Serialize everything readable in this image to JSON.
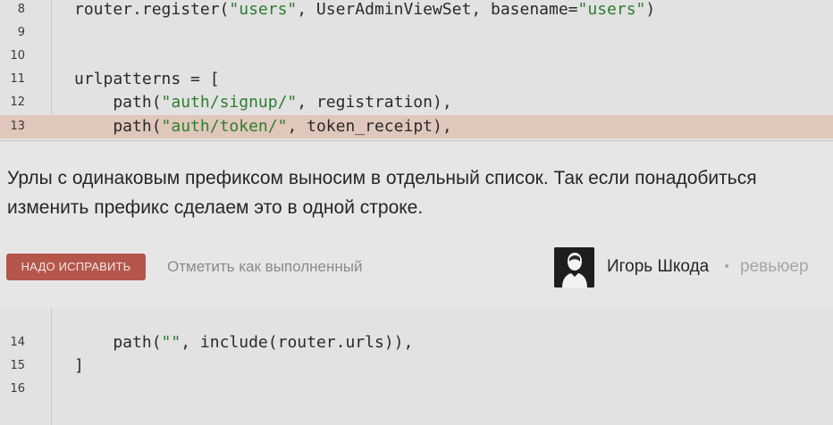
{
  "code_top": {
    "lines": [
      {
        "no": "8",
        "p1": "router.register(",
        "s1": "\"users\"",
        "p2": ", UserAdminViewSet, basename=",
        "s2": "\"users\"",
        "p3": ")"
      },
      {
        "no": "9"
      },
      {
        "no": "10"
      },
      {
        "no": "11",
        "p1": "urlpatterns = ["
      },
      {
        "no": "12",
        "p1": "    path(",
        "s1": "\"auth/signup/\"",
        "p2": ", registration),"
      },
      {
        "no": "13",
        "p1": "    path(",
        "s1": "\"auth/token/\"",
        "p2": ", token_receipt),"
      }
    ]
  },
  "comment": {
    "text": "Урлы с одинаковым префиксом выносим в отдельный список. Так если понадобиться изменить префикс сделаем это в одной строке.",
    "fix_button_label": "НАДО ИСПРАВИТЬ",
    "mark_done_label": "Отметить как выполненный",
    "author_name": "Игорь Шкода",
    "separator": "•",
    "author_role": "ревьюер",
    "avatar_icon": "user-silhouette-icon"
  },
  "code_bottom": {
    "lines": [
      {
        "no": "14",
        "p1": "    path(",
        "s1": "\"\"",
        "p2": ", include(router.urls)),"
      },
      {
        "no": "15",
        "p1": "]"
      },
      {
        "no": "16"
      }
    ]
  },
  "colors": {
    "string": "#2f7d32",
    "highlight_line": "#e0c7bb",
    "fix_button": "#b4564a"
  }
}
